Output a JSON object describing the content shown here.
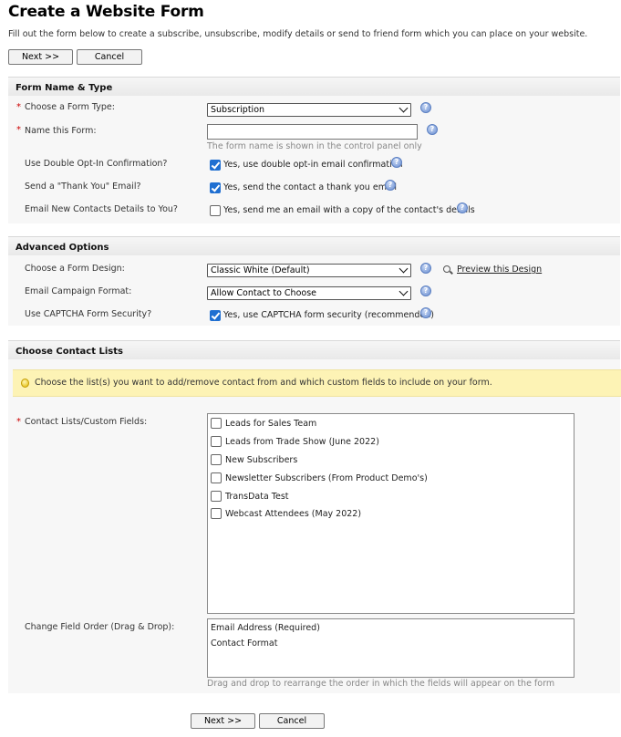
{
  "page": {
    "title": "Create a Website Form",
    "intro": "Fill out the form below to create a subscribe, unsubscribe, modify details or send to friend form which you can place on your website."
  },
  "buttons": {
    "next": "Next >>",
    "cancel": "Cancel"
  },
  "sections": {
    "form_name_type": "Form Name & Type",
    "advanced_options": "Advanced Options",
    "choose_contact_lists": "Choose Contact Lists"
  },
  "form_name_type": {
    "form_type_label": "Choose a Form Type:",
    "form_type_value": "Subscription",
    "form_name_label": "Name this Form:",
    "form_name_value": "",
    "form_name_hint": "The form name is shown in the control panel only",
    "double_optin_label": "Use Double Opt-In Confirmation?",
    "double_optin_text": "Yes, use double opt-in email confirmation",
    "thank_you_label": "Send a \"Thank You\" Email?",
    "thank_you_text": "Yes, send the contact a thank you email",
    "email_details_label": "Email New Contacts Details to You?",
    "email_details_text": "Yes, send me an email with a copy of the contact's details"
  },
  "advanced": {
    "design_label": "Choose a Form Design:",
    "design_value": "Classic White (Default)",
    "preview_link": "Preview this Design",
    "campaign_label": "Email Campaign Format:",
    "campaign_value": "Allow Contact to Choose",
    "captcha_label": "Use CAPTCHA Form Security?",
    "captcha_text": "Yes, use CAPTCHA form security (recommended)"
  },
  "contact_lists": {
    "tip": "Choose the list(s) you want to add/remove contact from and which custom fields to include on your form.",
    "lists_label": "Contact Lists/Custom Fields:",
    "items": [
      "Leads for Sales Team",
      "Leads from Trade Show (June 2022)",
      "New Subscribers",
      "Newsletter Subscribers (From Product Demo's)",
      "TransData Test",
      "Webcast Attendees (May 2022)"
    ],
    "order_label": "Change Field Order (Drag & Drop):",
    "order_items": [
      "Email Address (Required)",
      "Contact Format"
    ],
    "order_hint": "Drag and drop to rearrange the order in which the fields will appear on the form"
  },
  "icons": {
    "help": "help-icon",
    "check": "checkbox-icon",
    "preview": "magnifier-icon",
    "tip": "lightbulb-icon"
  },
  "colors": {
    "required": "#cc0000",
    "checkbox": "#1f6fd1",
    "tip_bg": "#fdf3b5"
  }
}
